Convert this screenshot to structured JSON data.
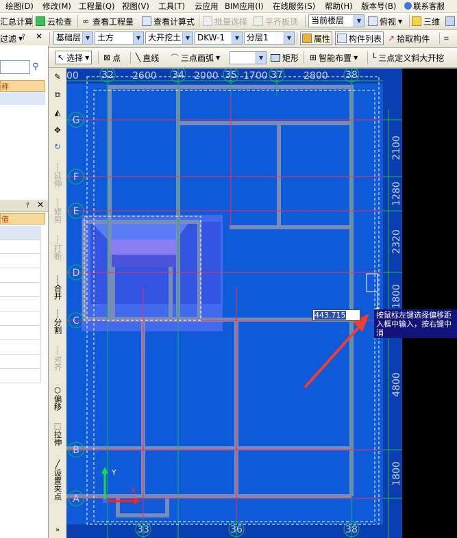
{
  "menubar": {
    "items": [
      "绘图(D)",
      "修改(M)",
      "工程量(Q)",
      "视图(V)",
      "工具(T)",
      "云应用",
      "BIM应用(I)",
      "在线服务(S)",
      "帮助(H)",
      "版本号(B)",
      "联系客服"
    ]
  },
  "toolbar1": {
    "summary_calc": "汇总计算",
    "cloud_check": "云检查",
    "view_quantity": "查看工程量",
    "view_formula": "查看计算式",
    "batch_select": "批量选择",
    "align_slab_top": "平齐板顶",
    "floor_select": "当前楼层",
    "view_mode": "俯视",
    "three_d": "三维"
  },
  "toolbar2": {
    "layer": "基础层",
    "category": "土方",
    "type": "大开挖土",
    "component": "DKW-1",
    "sublayer": "分层1",
    "properties": "属性",
    "component_list": "构件列表",
    "pick_component": "拾取构件"
  },
  "toolbar3": {
    "select": "选择",
    "point": "点",
    "line": "直线",
    "arc": "三点画弧",
    "rect": "矩形",
    "smart_place": "智能布置",
    "three_point_slope": "三点定义斜大开挖"
  },
  "left_panel": {
    "filter": "过滤",
    "col_name": "称",
    "col_value": "值"
  },
  "vertical_tools": [
    "延伸",
    "修剪",
    "打断",
    "合并",
    "分割",
    "对齐",
    "偏移",
    "拉伸",
    "设置夹点"
  ],
  "canvas": {
    "top_dims": [
      "00",
      "2600",
      "2000",
      "1700",
      "2800"
    ],
    "top_axes": [
      "32",
      "34",
      "35",
      "37",
      "38"
    ],
    "bottom_axes": [
      "33",
      "36",
      "38"
    ],
    "left_axes": [
      "G",
      "F",
      "E",
      "D",
      "C",
      "B",
      "A"
    ],
    "right_dims": [
      "2100",
      "1280",
      "2320",
      "1800",
      "4800",
      "1800"
    ],
    "offset_value": "443.715",
    "tooltip_lines": [
      "按鼠标左键选择偏移距",
      "入框中输入，按右键中",
      "消"
    ],
    "axis_x": "X",
    "axis_y": "Y"
  }
}
